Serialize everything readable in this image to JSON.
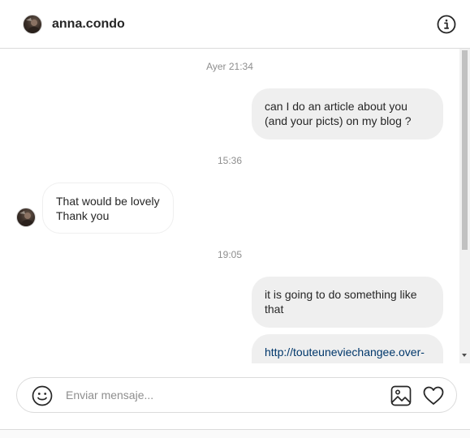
{
  "header": {
    "username": "anna.condo",
    "avatar_icon": "user-avatar",
    "info_icon": "info-icon"
  },
  "thread": {
    "messages": [
      {
        "type": "timestamp",
        "text": "Ayer 21:34"
      },
      {
        "type": "outgoing",
        "lines": [
          "can I do an article about you",
          "(and your picts) on my blog ?"
        ]
      },
      {
        "type": "timestamp",
        "text": "15:36"
      },
      {
        "type": "incoming",
        "lines": [
          "That would be lovely",
          "Thank you"
        ]
      },
      {
        "type": "timestamp",
        "text": "19:05"
      },
      {
        "type": "outgoing",
        "lines": [
          "it is going to do something like",
          "that"
        ]
      },
      {
        "type": "outgoing-link",
        "text": "http://touteuneviechangee.over-"
      }
    ]
  },
  "composer": {
    "placeholder": "Enviar mensaje...",
    "emoji_icon": "smiley-icon",
    "image_icon": "image-icon",
    "like_icon": "heart-icon"
  },
  "colors": {
    "bubble_outgoing": "#efefef",
    "border": "#dbdbdb",
    "link": "#00376b",
    "muted_text": "#8e8e8e",
    "text": "#262626"
  }
}
